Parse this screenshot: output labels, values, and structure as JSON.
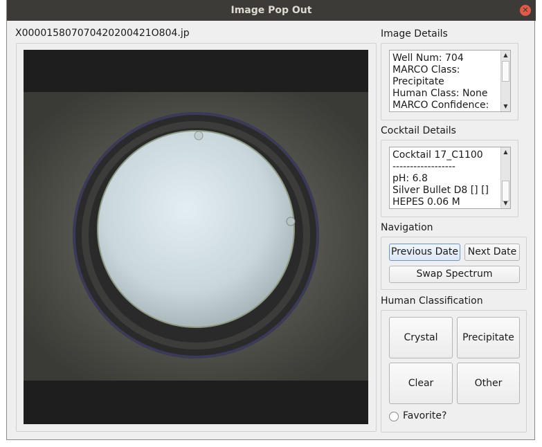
{
  "window": {
    "title": "Image Pop Out",
    "close_icon": "close-icon"
  },
  "image": {
    "filename": "X000015807070420200421O804.jp"
  },
  "image_details": {
    "heading": "Image Details",
    "lines": [
      "Well Num: 704",
      "MARCO Class:",
      "Precipitate",
      "Human Class: None",
      "MARCO Confidence:"
    ]
  },
  "cocktail_details": {
    "heading": "Cocktail Details",
    "lines": [
      "Cocktail 17_C1100",
      "------------------",
      "pH: 6.8",
      "Silver Bullet D8 [] []",
      "HEPES 0.06 M"
    ]
  },
  "navigation": {
    "heading": "Navigation",
    "previous_label": "Previous Date",
    "next_label": "Next Date",
    "swap_label": "Swap Spectrum"
  },
  "human_classification": {
    "heading": "Human Classification",
    "crystal_label": "Crystal",
    "precipitate_label": "Precipitate",
    "clear_label": "Clear",
    "other_label": "Other",
    "favorite_label": "Favorite?"
  },
  "colors": {
    "titlebar": "#3c3b37",
    "close": "#e25a45",
    "panel": "#efefef"
  }
}
